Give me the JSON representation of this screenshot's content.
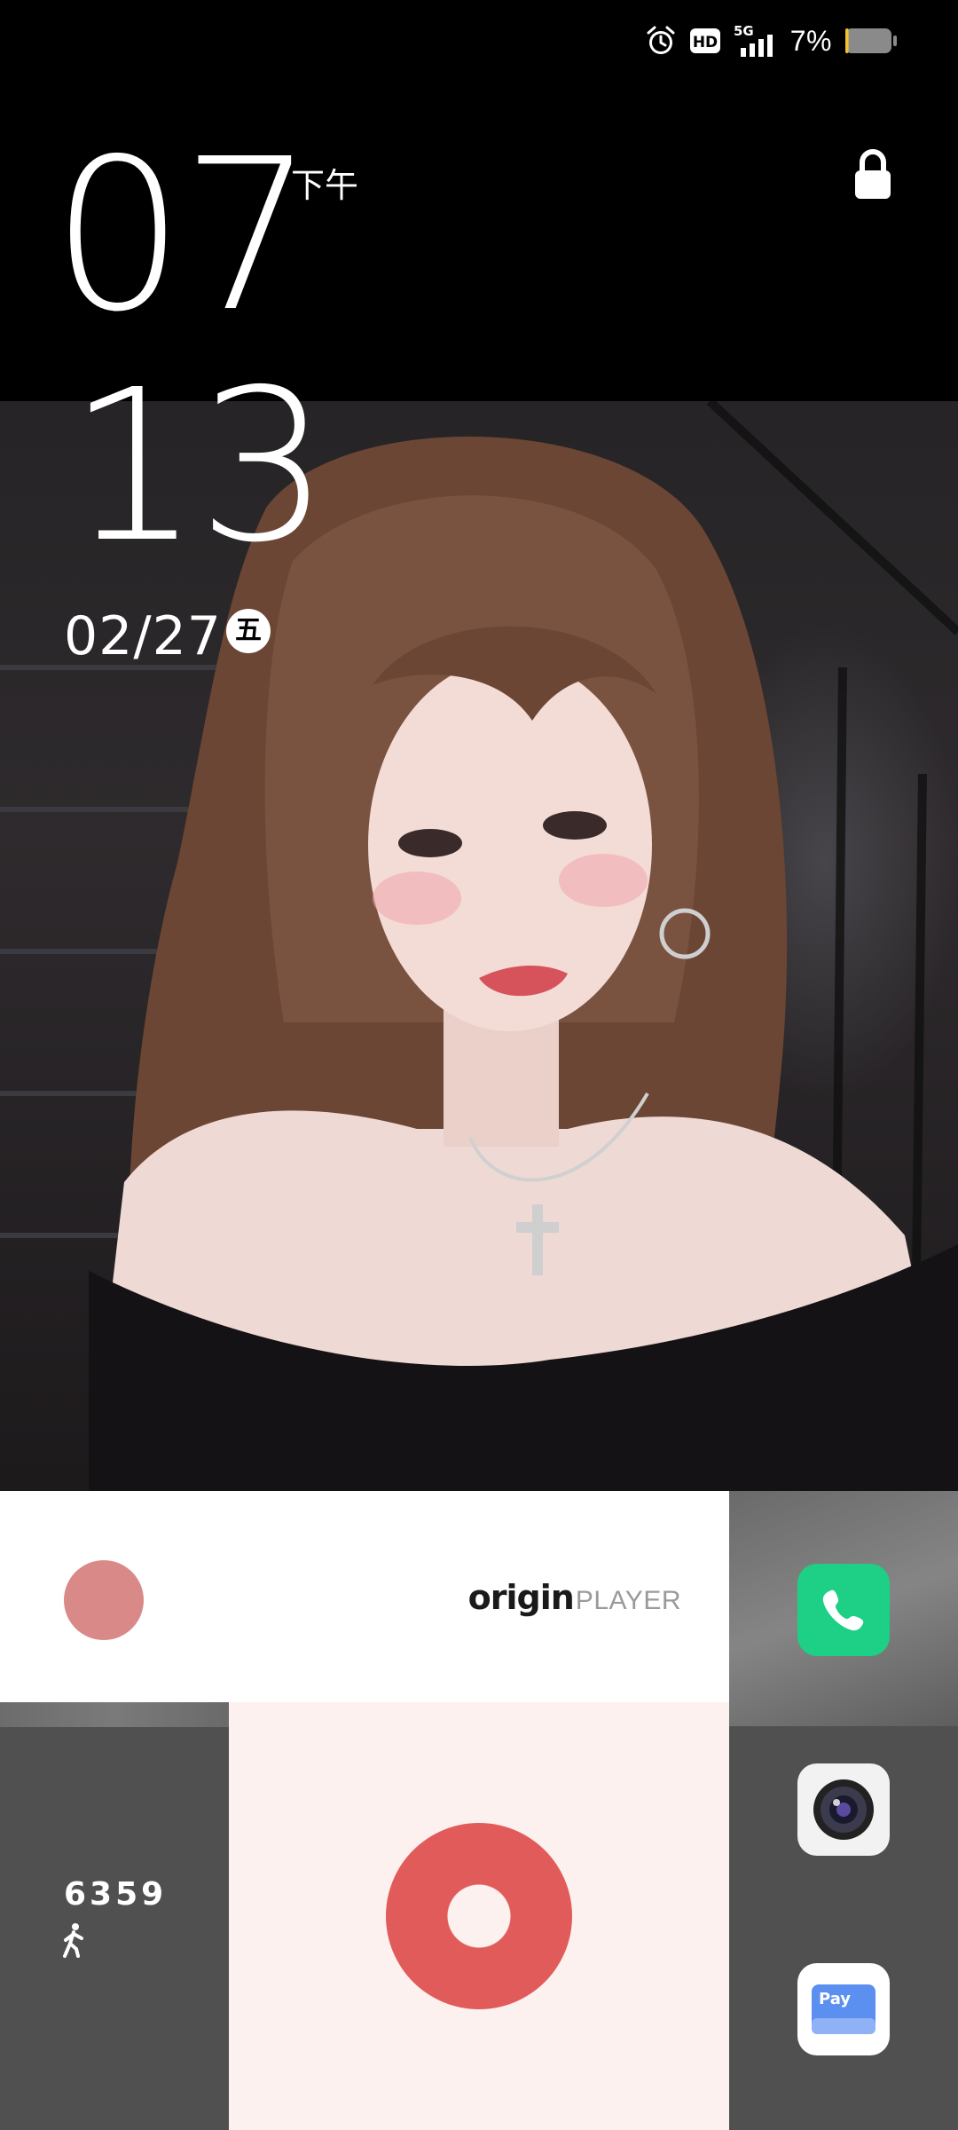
{
  "status_bar": {
    "icons": [
      "alarm-icon",
      "hd-icon",
      "5g-signal-icon",
      "battery-icon"
    ],
    "network": "5G",
    "hd_label": "HD",
    "battery_percent": "7%",
    "battery_level": 0.07,
    "battery_color": "#f2c230"
  },
  "lockscreen": {
    "hour": "07",
    "minute": "13",
    "ampm": "下午",
    "date": "02/27",
    "weekday": "五",
    "lock_icon": "lock-icon"
  },
  "widgets": {
    "player": {
      "brand_main": "origin",
      "brand_sub": "PLAYER",
      "dot_color": "#d98a88"
    },
    "steps": {
      "count": "6359",
      "icon": "walking-icon"
    },
    "record": {
      "color": "#e25b5b",
      "background": "#fcf1ef"
    }
  },
  "dock": {
    "apps": [
      {
        "name": "phone",
        "icon": "phone-icon",
        "color": "#1ecf86"
      },
      {
        "name": "camera",
        "icon": "camera-icon",
        "color": "#f2f2f2"
      },
      {
        "name": "pay",
        "icon": "pay-icon",
        "label": "Pay",
        "color": "#5b8ff0"
      }
    ]
  }
}
